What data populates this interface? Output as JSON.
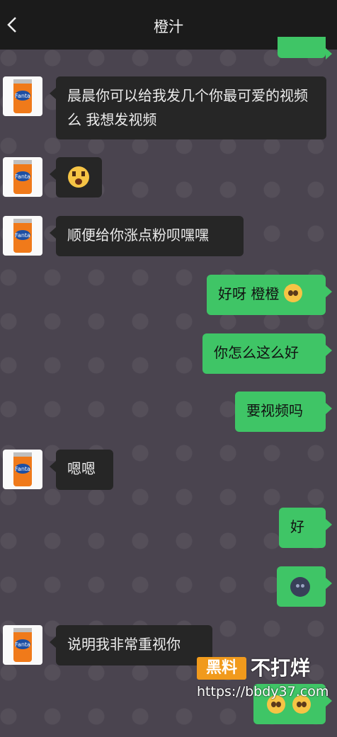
{
  "header": {
    "title": "橙汁",
    "back_icon": "chevron-left-icon"
  },
  "contact": {
    "avatar": "fanta-can-avatar"
  },
  "messages": [
    {
      "side": "in",
      "text": "晨晨你可以给我发几个你最可爱的视频么 我想发视频"
    },
    {
      "side": "in",
      "emoji": "surprised-face-emoji"
    },
    {
      "side": "in",
      "text": "顺便给你涨点粉呗嘿嘿"
    },
    {
      "side": "out",
      "text": "好呀 橙橙",
      "emoji": "pleading-face-emoji"
    },
    {
      "side": "out",
      "text": "你怎么这么好"
    },
    {
      "side": "out",
      "text": "要视频吗"
    },
    {
      "side": "in",
      "text": "嗯嗯"
    },
    {
      "side": "out",
      "text": "好"
    },
    {
      "side": "out",
      "emoji": "dark-moon-face-emoji"
    },
    {
      "side": "in",
      "text": "说明我非常重视你"
    },
    {
      "side": "out",
      "emoji": "pleading-face-emoji x2"
    }
  ],
  "watermark": {
    "badge": "黑料",
    "text": "不打烊",
    "url": "https://bbdy37.com"
  },
  "colors": {
    "header_bg": "#1b1b1b",
    "chat_bg": "#4a444f",
    "in_bubble": "#262626",
    "out_bubble": "#3fc566"
  }
}
